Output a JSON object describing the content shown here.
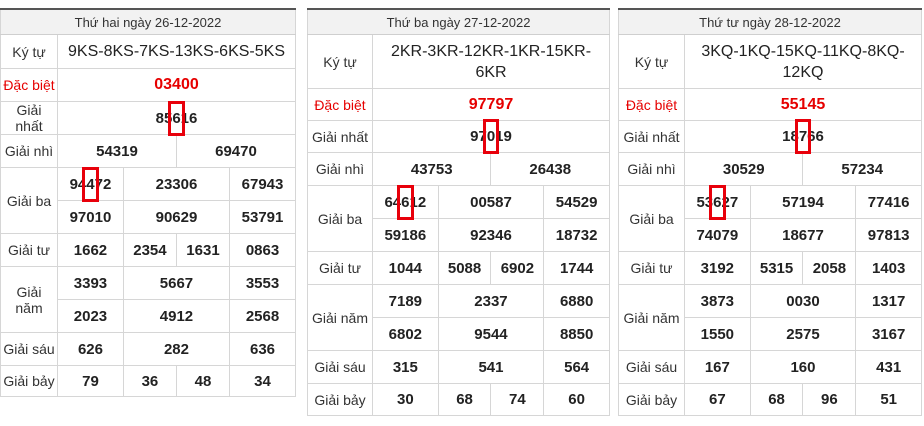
{
  "tables": [
    {
      "date_header": "Thứ hai ngày 26-12-2022",
      "ky_tu": "9KS-8KS-7KS-13KS-6KS-5KS",
      "dac_biet": "03400",
      "giai_nhat": {
        "pre": "85",
        "mark": "6",
        "post": "16"
      },
      "giai_nhi": [
        "54319",
        "69470"
      ],
      "giai_ba_row1": [
        {
          "pre": "94",
          "mark": "4",
          "post": "72"
        },
        "23306",
        "67943"
      ],
      "giai_ba_row2": [
        "97010",
        "90629",
        "53791"
      ],
      "giai_tu": [
        "1662",
        "2354",
        "1631",
        "0863"
      ],
      "giai_nam_row1": [
        "3393",
        "5667",
        "3553"
      ],
      "giai_nam_row2": [
        "2023",
        "4912",
        "2568"
      ],
      "giai_sau": [
        "626",
        "282",
        "636"
      ],
      "giai_bay": [
        "79",
        "36",
        "48",
        "34"
      ]
    },
    {
      "date_header": "Thứ ba ngày 27-12-2022",
      "ky_tu_line1": "2KR-3KR-12KR-1KR-15KR-",
      "ky_tu_line2": "6KR",
      "dac_biet": "97797",
      "giai_nhat": {
        "pre": "97",
        "mark": "0",
        "post": "19"
      },
      "giai_nhi": [
        "43753",
        "26438"
      ],
      "giai_ba_row1": [
        {
          "pre": "64",
          "mark": "6",
          "post": "12"
        },
        "00587",
        "54529"
      ],
      "giai_ba_row2": [
        "59186",
        "92346",
        "18732"
      ],
      "giai_tu": [
        "1044",
        "5088",
        "6902",
        "1744"
      ],
      "giai_nam_row1": [
        "7189",
        "2337",
        "6880"
      ],
      "giai_nam_row2": [
        "6802",
        "9544",
        "8850"
      ],
      "giai_sau": [
        "315",
        "541",
        "564"
      ],
      "giai_bay": [
        "30",
        "68",
        "74",
        "60"
      ]
    },
    {
      "date_header": "Thứ tư ngày 28-12-2022",
      "ky_tu_line1": "3KQ-1KQ-15KQ-11KQ-8KQ-",
      "ky_tu_line2": "12KQ",
      "dac_biet": "55145",
      "giai_nhat": {
        "pre": "18",
        "mark": "7",
        "post": "66"
      },
      "giai_nhi": [
        "30529",
        "57234"
      ],
      "giai_ba_row1": [
        {
          "pre": "53",
          "mark": "6",
          "post": "27"
        },
        "57194",
        "77416"
      ],
      "giai_ba_row2": [
        "74079",
        "18677",
        "97813"
      ],
      "giai_tu": [
        "3192",
        "5315",
        "2058",
        "1403"
      ],
      "giai_nam_row1": [
        "3873",
        "0030",
        "1317"
      ],
      "giai_nam_row2": [
        "1550",
        "2575",
        "3167"
      ],
      "giai_sau": [
        "167",
        "160",
        "431"
      ],
      "giai_bay": [
        "67",
        "68",
        "96",
        "51"
      ]
    }
  ],
  "labels": {
    "ky_tu": "Ký tự",
    "dac_biet": "Đặc biệt",
    "giai_nhat": "Giải nhất",
    "giai_nhi": "Giải nhì",
    "giai_ba": "Giải ba",
    "giai_tu": "Giải tư",
    "giai_nam": "Giải năm",
    "giai_sau": "Giải sáu",
    "giai_bay": "Giải bảy"
  },
  "colors": {
    "highlight": "#e60000",
    "header_bg": "#f2f2f2"
  }
}
